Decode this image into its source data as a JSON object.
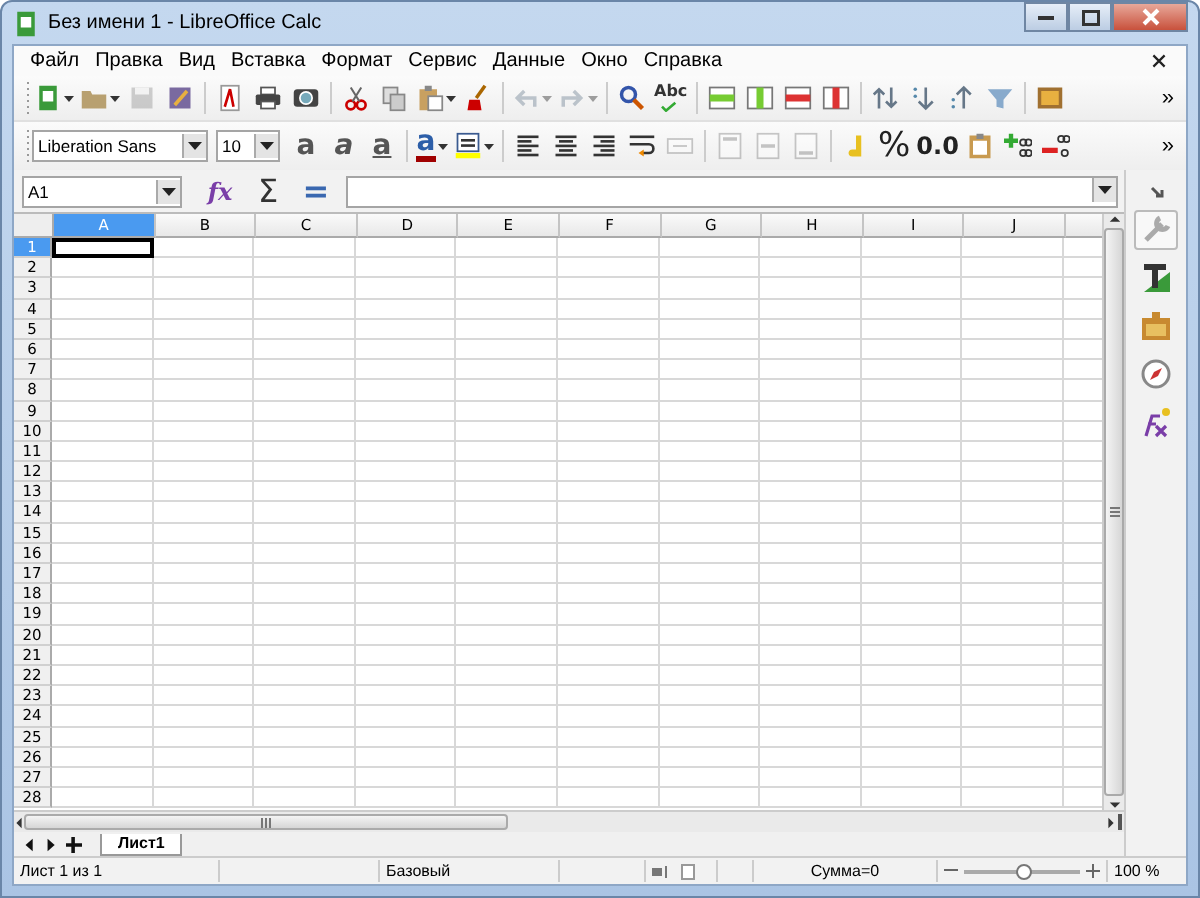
{
  "window": {
    "title": "Без имени 1 - LibreOffice Calc"
  },
  "menu": {
    "items": [
      {
        "label": "Файл"
      },
      {
        "label": "Правка"
      },
      {
        "label": "Вид"
      },
      {
        "label": "Вставка"
      },
      {
        "label": "Формат"
      },
      {
        "label": "Сервис"
      },
      {
        "label": "Данные"
      },
      {
        "label": "Окно"
      },
      {
        "label": "Справка"
      }
    ]
  },
  "standard_toolbar": {
    "groups": [
      [
        {
          "kind": "new",
          "dropdown": true,
          "disabled": false
        },
        {
          "kind": "open",
          "dropdown": true,
          "disabled": false
        },
        {
          "kind": "save",
          "dropdown": false,
          "disabled": true
        },
        {
          "kind": "edit",
          "dropdown": false,
          "disabled": false
        }
      ],
      [
        {
          "kind": "pdf",
          "dropdown": false,
          "disabled": false
        },
        {
          "kind": "print",
          "dropdown": false,
          "disabled": false
        },
        {
          "kind": "preview",
          "dropdown": false,
          "disabled": false
        }
      ],
      [
        {
          "kind": "cut",
          "dropdown": false,
          "disabled": false
        },
        {
          "kind": "copy",
          "dropdown": false,
          "disabled": false
        },
        {
          "kind": "paste",
          "dropdown": true,
          "disabled": false
        },
        {
          "kind": "clone",
          "dropdown": false,
          "disabled": false
        }
      ],
      [
        {
          "kind": "undo",
          "dropdown": true,
          "disabled": true
        },
        {
          "kind": "redo",
          "dropdown": true,
          "disabled": true
        }
      ],
      [
        {
          "kind": "find",
          "dropdown": false,
          "disabled": false
        },
        {
          "kind": "spellcheck",
          "text": "Abc",
          "dropdown": false,
          "disabled": false
        }
      ],
      [
        {
          "kind": "insert_row",
          "dropdown": false,
          "disabled": false
        },
        {
          "kind": "insert_column",
          "dropdown": false,
          "disabled": false
        },
        {
          "kind": "delete_row",
          "dropdown": false,
          "disabled": false
        },
        {
          "kind": "delete_column",
          "dropdown": false,
          "disabled": false
        }
      ],
      [
        {
          "kind": "sort",
          "dropdown": false,
          "disabled": false
        },
        {
          "kind": "sort_descending",
          "dropdown": false,
          "disabled": false
        },
        {
          "kind": "sort_ascending",
          "dropdown": false,
          "disabled": false
        },
        {
          "kind": "filter",
          "dropdown": false,
          "disabled": false
        }
      ],
      [
        {
          "kind": "image",
          "dropdown": false,
          "disabled": false
        }
      ]
    ],
    "overflow": "»"
  },
  "formatting_toolbar": {
    "font_name": "Liberation Sans",
    "font_size": "10",
    "groups": [
      [
        {
          "kind": "bold",
          "text": "a",
          "dropdown": false,
          "disabled": false
        },
        {
          "kind": "italic",
          "text": "a",
          "dropdown": false,
          "disabled": false
        },
        {
          "kind": "underline",
          "text": "a",
          "dropdown": false,
          "disabled": false
        }
      ],
      [
        {
          "kind": "font_color",
          "text": "a",
          "dropdown": true,
          "disabled": false
        },
        {
          "kind": "highlight",
          "dropdown": true,
          "disabled": false
        }
      ],
      [
        {
          "kind": "align_left",
          "dropdown": false,
          "disabled": false
        },
        {
          "kind": "align_center",
          "dropdown": false,
          "disabled": false
        },
        {
          "kind": "align_right",
          "dropdown": false,
          "disabled": false
        },
        {
          "kind": "wrap",
          "dropdown": false,
          "disabled": false
        },
        {
          "kind": "merge",
          "dropdown": false,
          "disabled": true
        }
      ],
      [
        {
          "kind": "align_top",
          "dropdown": false,
          "disabled": true
        },
        {
          "kind": "align_middle",
          "dropdown": false,
          "disabled": true
        },
        {
          "kind": "align_bottom",
          "dropdown": false,
          "disabled": true
        }
      ],
      [
        {
          "kind": "currency",
          "dropdown": false,
          "disabled": false
        },
        {
          "kind": "percent",
          "text": "%",
          "dropdown": false,
          "disabled": false
        },
        {
          "kind": "number",
          "text": "0.0",
          "dropdown": false,
          "disabled": false
        },
        {
          "kind": "date",
          "dropdown": false,
          "disabled": false
        },
        {
          "kind": "add_decimal",
          "dropdown": false,
          "disabled": false
        },
        {
          "kind": "delete_decimal",
          "dropdown": false,
          "disabled": false
        }
      ]
    ],
    "overflow": "»"
  },
  "formula_bar": {
    "name_box": "A1",
    "function_wizard": "fx",
    "sum": "Σ",
    "formula": "="
  },
  "sheet": {
    "columns": [
      {
        "label": "A",
        "selected": true
      },
      {
        "label": "B",
        "selected": false
      },
      {
        "label": "C",
        "selected": false
      },
      {
        "label": "D",
        "selected": false
      },
      {
        "label": "E",
        "selected": false
      },
      {
        "label": "F",
        "selected": false
      },
      {
        "label": "G",
        "selected": false
      },
      {
        "label": "H",
        "selected": false
      },
      {
        "label": "I",
        "selected": false
      },
      {
        "label": "J",
        "selected": false
      }
    ],
    "rows": [
      {
        "label": "1",
        "selected": true
      },
      {
        "label": "2",
        "selected": false
      },
      {
        "label": "3",
        "selected": false
      },
      {
        "label": "4",
        "selected": false
      },
      {
        "label": "5",
        "selected": false
      },
      {
        "label": "6",
        "selected": false
      },
      {
        "label": "7",
        "selected": false
      },
      {
        "label": "8",
        "selected": false
      },
      {
        "label": "9",
        "selected": false
      },
      {
        "label": "10",
        "selected": false
      },
      {
        "label": "11",
        "selected": false
      },
      {
        "label": "12",
        "selected": false
      },
      {
        "label": "13",
        "selected": false
      },
      {
        "label": "14",
        "selected": false
      },
      {
        "label": "15",
        "selected": false
      },
      {
        "label": "16",
        "selected": false
      },
      {
        "label": "17",
        "selected": false
      },
      {
        "label": "18",
        "selected": false
      },
      {
        "label": "19",
        "selected": false
      },
      {
        "label": "20",
        "selected": false
      },
      {
        "label": "21",
        "selected": false
      },
      {
        "label": "22",
        "selected": false
      },
      {
        "label": "23",
        "selected": false
      },
      {
        "label": "24",
        "selected": false
      },
      {
        "label": "25",
        "selected": false
      },
      {
        "label": "26",
        "selected": false
      },
      {
        "label": "27",
        "selected": false
      },
      {
        "label": "28",
        "selected": false
      }
    ]
  },
  "sheet_tabs": [
    {
      "label": "Лист1",
      "selected": true
    }
  ],
  "sidebar": {
    "items": [
      {
        "kind": "properties",
        "selected": true
      },
      {
        "kind": "styles",
        "selected": false
      },
      {
        "kind": "gallery",
        "selected": false
      },
      {
        "kind": "navigator",
        "selected": false
      },
      {
        "kind": "functions",
        "selected": false
      }
    ]
  },
  "status_bar": {
    "sheet_info": "Лист 1 из 1",
    "page_style": "Базовый",
    "sum": "Сумма=0",
    "zoom": {
      "level": 0.52,
      "percent": "100 %"
    }
  }
}
